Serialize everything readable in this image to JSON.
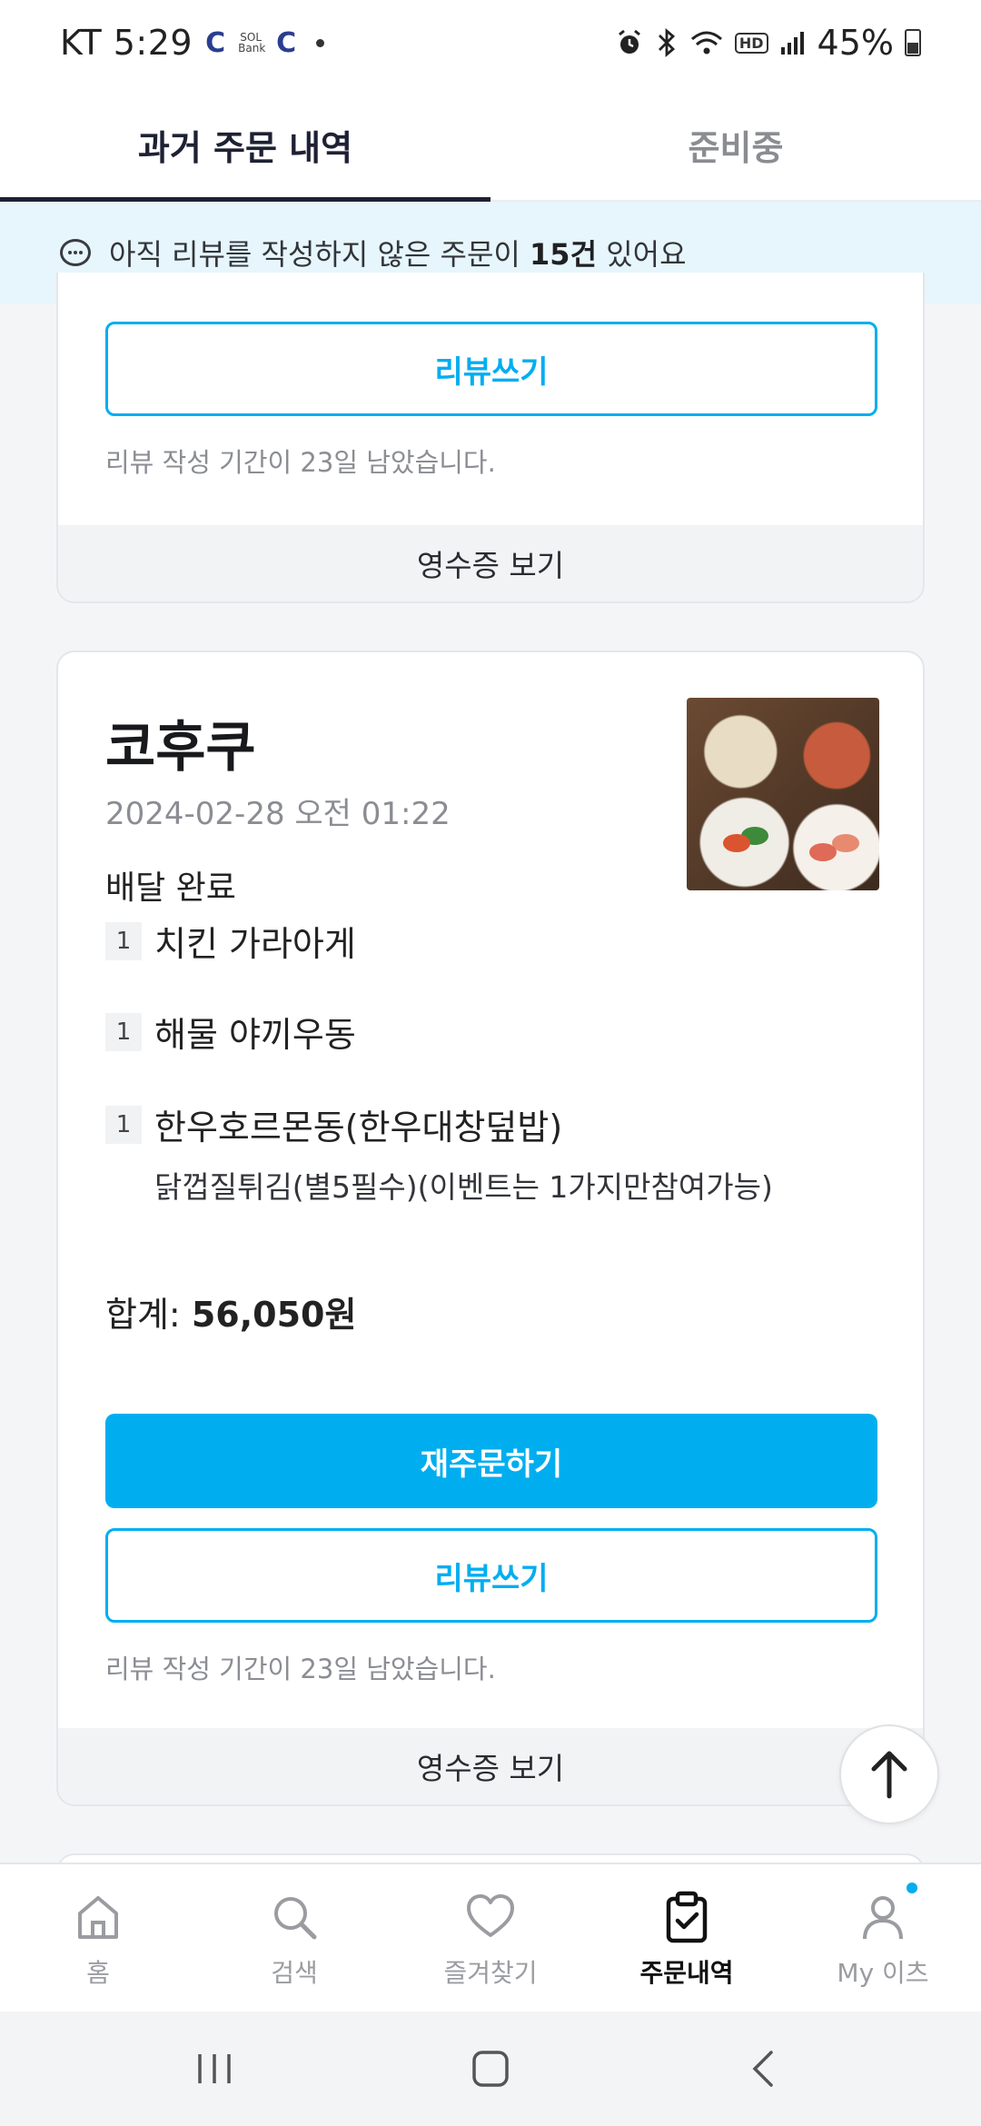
{
  "status_bar": {
    "carrier_time": "KT 5:29",
    "app_icon_c": "C",
    "sol_bank_top": "SOL",
    "sol_bank_bottom": "Bank",
    "battery": "45%"
  },
  "tabs": {
    "past_orders": "과거 주문 내역",
    "preparing": "준비중"
  },
  "banner": {
    "prefix": "아직 리뷰를 작성하지 않은 주문이 ",
    "count": "15건",
    "suffix": " 있어요"
  },
  "card1": {
    "write_review": "리뷰쓰기",
    "review_note": "리뷰 작성 기간이 23일 남았습니다.",
    "view_receipt": "영수증 보기"
  },
  "card2": {
    "shop_name": "코후쿠",
    "date": "2024-02-28 오전 01:22",
    "status": "배달 완료",
    "items": [
      {
        "qty": "1",
        "name": "치킨 가라아게"
      },
      {
        "qty": "1",
        "name": "해물 야끼우동"
      },
      {
        "qty": "1",
        "name": "한우호르몬동(한우대창덮밥)",
        "option": "닭껍질튀김(별5필수)(이벤트는 1가지만참여가능)"
      }
    ],
    "total_label": "합계: ",
    "total_value": "56,050원",
    "reorder": "재주문하기",
    "write_review": "리뷰쓰기",
    "review_note": "리뷰 작성 기간이 23일 남았습니다.",
    "view_receipt": "영수증 보기"
  },
  "bottom_nav": {
    "home": "홈",
    "search": "검색",
    "favorites": "즐겨찾기",
    "orders": "주문내역",
    "my": "My 이츠"
  },
  "colors": {
    "accent": "#00aef0",
    "active_text": "#1d2133",
    "banner_bg": "#e6f6fc"
  }
}
